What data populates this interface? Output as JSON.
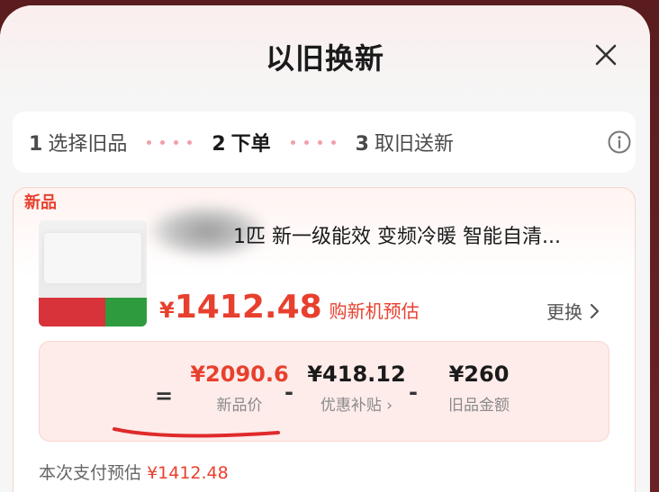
{
  "sheet": {
    "title": "以旧换新"
  },
  "steps": [
    {
      "num": "1",
      "label": "选择旧品"
    },
    {
      "num": "2",
      "label": "下单"
    },
    {
      "num": "3",
      "label": "取旧送新"
    }
  ],
  "product": {
    "badge": "新品",
    "name": "1匹 新一级能效 变频冷暖 智能自清...",
    "price_currency": "¥",
    "price": "1412.48",
    "price_note": "购新机预估",
    "change_label": "更换"
  },
  "calc": {
    "equals": "=",
    "new_price_value": "¥2090.6",
    "new_price_label": "新品价",
    "minus1": "-",
    "subsidy_value": "¥418.12",
    "subsidy_label": "优惠补贴 ›",
    "minus2": "-",
    "old_value": "¥260",
    "old_label": "旧品金额"
  },
  "payment": {
    "label": "本次支付预估",
    "amount": "¥1412.48"
  },
  "colors": {
    "accent": "#e8402e",
    "step_dot": "#f0a0a8",
    "calc_bg": "#fdecea"
  }
}
